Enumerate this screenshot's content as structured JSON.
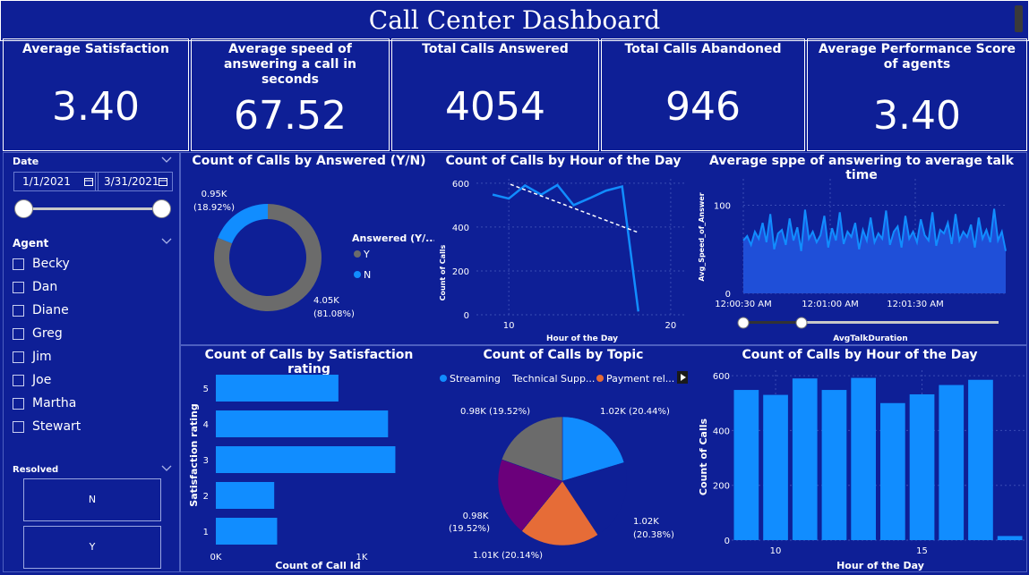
{
  "dashboard": {
    "title": "Call Center Dashboard"
  },
  "cards": [
    {
      "label": "Average Satisfaction",
      "value": "3.40"
    },
    {
      "label": "Average speed of answering a call in seconds",
      "value": "67.52"
    },
    {
      "label": "Total Calls Answered",
      "value": "4054"
    },
    {
      "label": "Total Calls Abandoned",
      "value": "946"
    },
    {
      "label": "Average Performance Score of agents",
      "value": "3.40"
    }
  ],
  "date_slicer": {
    "label": "Date",
    "start": "1/1/2021",
    "end": "3/31/2021"
  },
  "agent_slicer": {
    "label": "Agent",
    "items": [
      "Becky",
      "Dan",
      "Diane",
      "Greg",
      "Jim",
      "Joe",
      "Martha",
      "Stewart"
    ]
  },
  "resolved_slicer": {
    "label": "Resolved",
    "options": [
      "N",
      "Y"
    ]
  },
  "colors": {
    "background": "#0e1f96",
    "blue": "#118dff",
    "grey": "#6b6b6b",
    "purple": "#6b007b",
    "orange": "#e66c37",
    "fill": "#1f4fd8"
  },
  "chart_data": [
    {
      "type": "pie",
      "variant": "donut",
      "title": "Count of Calls by Answered (Y/N)",
      "legend_title": "Answered (Y/...",
      "legend_position": "right",
      "slices": [
        {
          "name": "Y",
          "value": 4050,
          "label": "4.05K\n(81.08%)",
          "label_lines": [
            "4.05K",
            "(81.08%)"
          ],
          "color": "#6b6b6b"
        },
        {
          "name": "N",
          "value": 950,
          "label": "0.95K\n(18.92%)",
          "label_lines": [
            "0.95K",
            "(18.92%)"
          ],
          "color": "#118dff"
        }
      ]
    },
    {
      "type": "line",
      "title": "Count of Calls by Hour of the Day",
      "xlabel": "Hour of the Day",
      "ylabel": "Count of Calls",
      "x_ticks": [
        "10",
        "20"
      ],
      "y_ticks": [
        "0",
        "200",
        "400",
        "600"
      ],
      "xlim": [
        8,
        21
      ],
      "ylim": [
        0,
        620
      ],
      "grid": true,
      "series": [
        {
          "x": [
            9,
            10,
            11,
            12,
            13,
            14,
            15,
            16,
            17,
            18
          ],
          "values": [
            548,
            530,
            590,
            548,
            592,
            500,
            532,
            566,
            585,
            15
          ]
        }
      ],
      "trend_line": {
        "x": [
          10.1,
          18
        ],
        "values": [
          595,
          375
        ],
        "style": "dashed"
      }
    },
    {
      "type": "area",
      "title": "Average sppe of answering to average talk time",
      "xlabel": "AvgTalkDuration",
      "ylabel": "Avg_Speed_of_Answer",
      "x_ticks": [
        "12:00:30 AM",
        "12:01:00 AM",
        "12:01:30 AM"
      ],
      "y_ticks": [
        "0",
        "100"
      ],
      "ylim": [
        0,
        130
      ],
      "grid": true,
      "series": [
        {
          "values": [
            60,
            65,
            55,
            70,
            62,
            80,
            58,
            90,
            50,
            68,
            72,
            55,
            85,
            60,
            75,
            48,
            95,
            62,
            70,
            58,
            66,
            88,
            52,
            74,
            60,
            92,
            56,
            70,
            64,
            80,
            50,
            72,
            60,
            86,
            58,
            68,
            62,
            94,
            55,
            70,
            76,
            52,
            88,
            62,
            70,
            58,
            84,
            66,
            60,
            92,
            54,
            72,
            68,
            80,
            56,
            90,
            60,
            70,
            64,
            78,
            52,
            86,
            62,
            72,
            58,
            96,
            60,
            70,
            48
          ]
        }
      ]
    },
    {
      "type": "bar",
      "orientation": "horizontal",
      "title": "Count of Calls by Satisfaction rating",
      "xlabel": "Count of Call Id",
      "ylabel": "Satisfaction rating",
      "categories": [
        "5",
        "4",
        "3",
        "2",
        "1"
      ],
      "values": [
        840,
        1180,
        1230,
        400,
        420
      ],
      "x_ticks": [
        "0K",
        "1K"
      ],
      "xlim": [
        0,
        1350
      ]
    },
    {
      "type": "pie",
      "title": "Count of Calls by Topic",
      "legend_position": "top",
      "legend": [
        "Streaming",
        "Technical Supp...",
        "Payment rel..."
      ],
      "slices": [
        {
          "name": "Streaming",
          "value": 1020,
          "label": "1.02K (20.44%)",
          "label_lines": [
            "1.02K (20.44%)"
          ],
          "color": "#118dff"
        },
        {
          "name": "",
          "value": 1020,
          "label": "1.02K\n(20.38%)",
          "label_lines": [
            "1.02K",
            "(20.38%)"
          ],
          "color": "#0e1f96"
        },
        {
          "name": "Payment rel...",
          "value": 1010,
          "label": "1.01K (20.14%)",
          "label_lines": [
            "1.01K (20.14%)"
          ],
          "color": "#e66c37"
        },
        {
          "name": "",
          "value": 980,
          "label": "0.98K\n(19.52%)",
          "label_lines": [
            "0.98K",
            "(19.52%)"
          ],
          "color": "#6b007b"
        },
        {
          "name": "",
          "value": 980,
          "label": "0.98K (19.52%)",
          "label_lines": [
            "0.98K (19.52%)"
          ],
          "color": "#6b6b6b"
        }
      ]
    },
    {
      "type": "bar",
      "title": "Count of Calls by Hour of the Day",
      "xlabel": "Hour of the Day",
      "ylabel": "Count of Calls",
      "x": [
        9,
        10,
        11,
        12,
        13,
        14,
        15,
        16,
        17,
        18
      ],
      "values": [
        548,
        530,
        590,
        548,
        592,
        500,
        532,
        566,
        585,
        15
      ],
      "x_ticks": [
        "10",
        "15"
      ],
      "y_ticks": [
        "0",
        "200",
        "400",
        "600"
      ],
      "ylim": [
        0,
        620
      ],
      "grid": true
    }
  ]
}
